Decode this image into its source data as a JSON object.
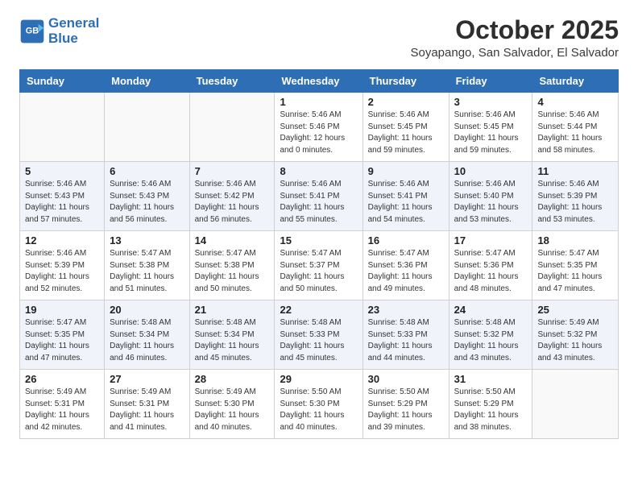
{
  "header": {
    "logo_line1": "General",
    "logo_line2": "Blue",
    "month_title": "October 2025",
    "location": "Soyapango, San Salvador, El Salvador"
  },
  "weekdays": [
    "Sunday",
    "Monday",
    "Tuesday",
    "Wednesday",
    "Thursday",
    "Friday",
    "Saturday"
  ],
  "weeks": [
    [
      {
        "day": "",
        "sunrise": "",
        "sunset": "",
        "daylight": ""
      },
      {
        "day": "",
        "sunrise": "",
        "sunset": "",
        "daylight": ""
      },
      {
        "day": "",
        "sunrise": "",
        "sunset": "",
        "daylight": ""
      },
      {
        "day": "1",
        "sunrise": "Sunrise: 5:46 AM",
        "sunset": "Sunset: 5:46 PM",
        "daylight": "Daylight: 12 hours and 0 minutes."
      },
      {
        "day": "2",
        "sunrise": "Sunrise: 5:46 AM",
        "sunset": "Sunset: 5:45 PM",
        "daylight": "Daylight: 11 hours and 59 minutes."
      },
      {
        "day": "3",
        "sunrise": "Sunrise: 5:46 AM",
        "sunset": "Sunset: 5:45 PM",
        "daylight": "Daylight: 11 hours and 59 minutes."
      },
      {
        "day": "4",
        "sunrise": "Sunrise: 5:46 AM",
        "sunset": "Sunset: 5:44 PM",
        "daylight": "Daylight: 11 hours and 58 minutes."
      }
    ],
    [
      {
        "day": "5",
        "sunrise": "Sunrise: 5:46 AM",
        "sunset": "Sunset: 5:43 PM",
        "daylight": "Daylight: 11 hours and 57 minutes."
      },
      {
        "day": "6",
        "sunrise": "Sunrise: 5:46 AM",
        "sunset": "Sunset: 5:43 PM",
        "daylight": "Daylight: 11 hours and 56 minutes."
      },
      {
        "day": "7",
        "sunrise": "Sunrise: 5:46 AM",
        "sunset": "Sunset: 5:42 PM",
        "daylight": "Daylight: 11 hours and 56 minutes."
      },
      {
        "day": "8",
        "sunrise": "Sunrise: 5:46 AM",
        "sunset": "Sunset: 5:41 PM",
        "daylight": "Daylight: 11 hours and 55 minutes."
      },
      {
        "day": "9",
        "sunrise": "Sunrise: 5:46 AM",
        "sunset": "Sunset: 5:41 PM",
        "daylight": "Daylight: 11 hours and 54 minutes."
      },
      {
        "day": "10",
        "sunrise": "Sunrise: 5:46 AM",
        "sunset": "Sunset: 5:40 PM",
        "daylight": "Daylight: 11 hours and 53 minutes."
      },
      {
        "day": "11",
        "sunrise": "Sunrise: 5:46 AM",
        "sunset": "Sunset: 5:39 PM",
        "daylight": "Daylight: 11 hours and 53 minutes."
      }
    ],
    [
      {
        "day": "12",
        "sunrise": "Sunrise: 5:46 AM",
        "sunset": "Sunset: 5:39 PM",
        "daylight": "Daylight: 11 hours and 52 minutes."
      },
      {
        "day": "13",
        "sunrise": "Sunrise: 5:47 AM",
        "sunset": "Sunset: 5:38 PM",
        "daylight": "Daylight: 11 hours and 51 minutes."
      },
      {
        "day": "14",
        "sunrise": "Sunrise: 5:47 AM",
        "sunset": "Sunset: 5:38 PM",
        "daylight": "Daylight: 11 hours and 50 minutes."
      },
      {
        "day": "15",
        "sunrise": "Sunrise: 5:47 AM",
        "sunset": "Sunset: 5:37 PM",
        "daylight": "Daylight: 11 hours and 50 minutes."
      },
      {
        "day": "16",
        "sunrise": "Sunrise: 5:47 AM",
        "sunset": "Sunset: 5:36 PM",
        "daylight": "Daylight: 11 hours and 49 minutes."
      },
      {
        "day": "17",
        "sunrise": "Sunrise: 5:47 AM",
        "sunset": "Sunset: 5:36 PM",
        "daylight": "Daylight: 11 hours and 48 minutes."
      },
      {
        "day": "18",
        "sunrise": "Sunrise: 5:47 AM",
        "sunset": "Sunset: 5:35 PM",
        "daylight": "Daylight: 11 hours and 47 minutes."
      }
    ],
    [
      {
        "day": "19",
        "sunrise": "Sunrise: 5:47 AM",
        "sunset": "Sunset: 5:35 PM",
        "daylight": "Daylight: 11 hours and 47 minutes."
      },
      {
        "day": "20",
        "sunrise": "Sunrise: 5:48 AM",
        "sunset": "Sunset: 5:34 PM",
        "daylight": "Daylight: 11 hours and 46 minutes."
      },
      {
        "day": "21",
        "sunrise": "Sunrise: 5:48 AM",
        "sunset": "Sunset: 5:34 PM",
        "daylight": "Daylight: 11 hours and 45 minutes."
      },
      {
        "day": "22",
        "sunrise": "Sunrise: 5:48 AM",
        "sunset": "Sunset: 5:33 PM",
        "daylight": "Daylight: 11 hours and 45 minutes."
      },
      {
        "day": "23",
        "sunrise": "Sunrise: 5:48 AM",
        "sunset": "Sunset: 5:33 PM",
        "daylight": "Daylight: 11 hours and 44 minutes."
      },
      {
        "day": "24",
        "sunrise": "Sunrise: 5:48 AM",
        "sunset": "Sunset: 5:32 PM",
        "daylight": "Daylight: 11 hours and 43 minutes."
      },
      {
        "day": "25",
        "sunrise": "Sunrise: 5:49 AM",
        "sunset": "Sunset: 5:32 PM",
        "daylight": "Daylight: 11 hours and 43 minutes."
      }
    ],
    [
      {
        "day": "26",
        "sunrise": "Sunrise: 5:49 AM",
        "sunset": "Sunset: 5:31 PM",
        "daylight": "Daylight: 11 hours and 42 minutes."
      },
      {
        "day": "27",
        "sunrise": "Sunrise: 5:49 AM",
        "sunset": "Sunset: 5:31 PM",
        "daylight": "Daylight: 11 hours and 41 minutes."
      },
      {
        "day": "28",
        "sunrise": "Sunrise: 5:49 AM",
        "sunset": "Sunset: 5:30 PM",
        "daylight": "Daylight: 11 hours and 40 minutes."
      },
      {
        "day": "29",
        "sunrise": "Sunrise: 5:50 AM",
        "sunset": "Sunset: 5:30 PM",
        "daylight": "Daylight: 11 hours and 40 minutes."
      },
      {
        "day": "30",
        "sunrise": "Sunrise: 5:50 AM",
        "sunset": "Sunset: 5:29 PM",
        "daylight": "Daylight: 11 hours and 39 minutes."
      },
      {
        "day": "31",
        "sunrise": "Sunrise: 5:50 AM",
        "sunset": "Sunset: 5:29 PM",
        "daylight": "Daylight: 11 hours and 38 minutes."
      },
      {
        "day": "",
        "sunrise": "",
        "sunset": "",
        "daylight": ""
      }
    ]
  ]
}
